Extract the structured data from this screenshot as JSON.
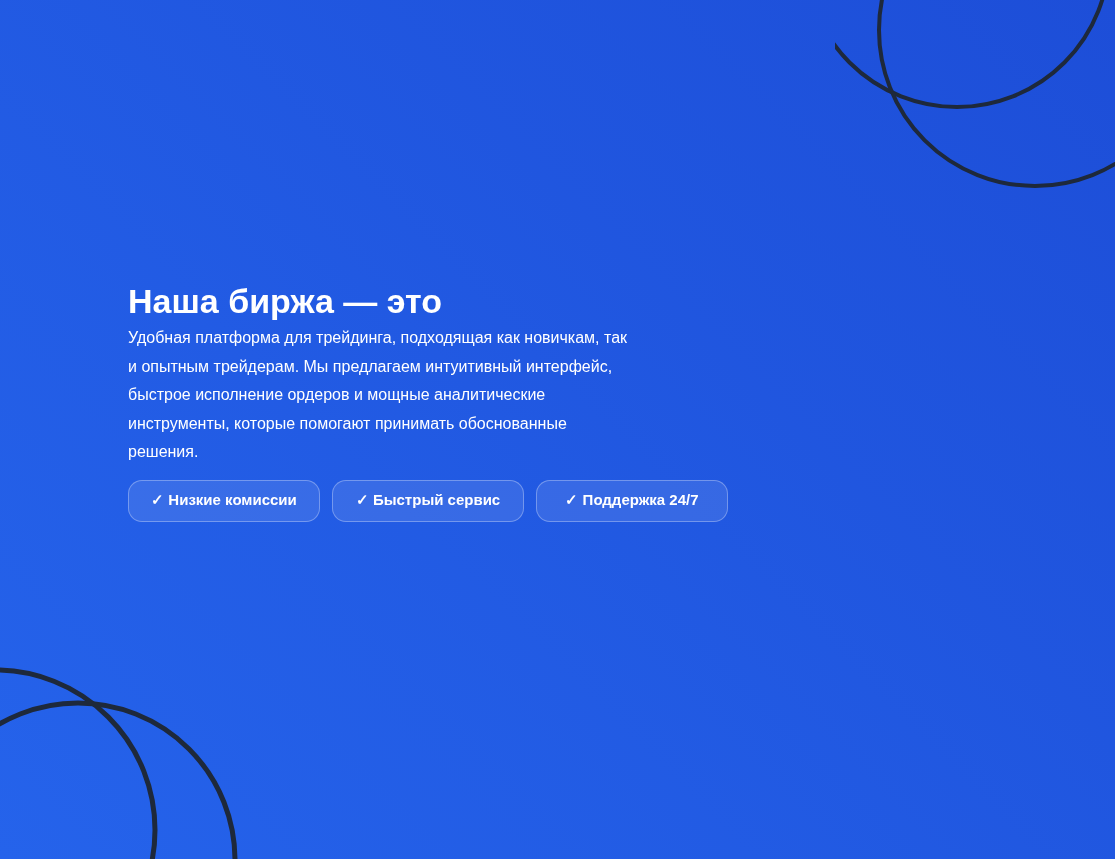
{
  "hero": {
    "title": "Наша биржа — это",
    "description": "Удобная платформа для трейдинга, подходящая как новичкам, так и опытным трейдерам. Мы предлагаем интуитивный интерфейс, быстрое исполнение ордеров и мощные аналитические инструменты, которые помогают принимать обоснованные решения.",
    "features": [
      "✓ Низкие комиссии",
      "✓ Быстрый сервис",
      "✓ Поддержка 24/7"
    ]
  }
}
